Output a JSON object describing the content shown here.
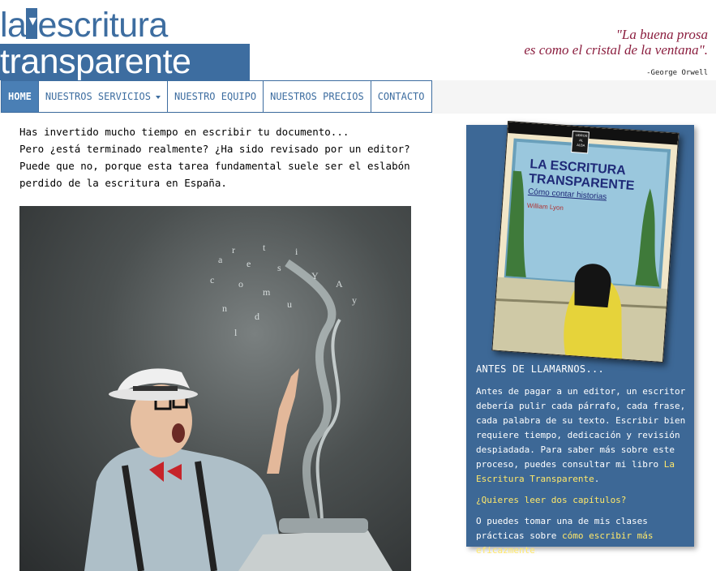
{
  "logo": {
    "line1": "la escritura",
    "line2": "transparente"
  },
  "quote": {
    "line1": "\"La buena prosa",
    "line2": "es como el cristal de la ventana\".",
    "author": "-George Orwell"
  },
  "nav": {
    "home": "HOME",
    "services": "NUESTROS SERVICIOS",
    "team": "NUESTRO EQUIPO",
    "prices": "NUESTROS PRECIOS",
    "contact": "CONTACTO"
  },
  "intro": {
    "line1": "Has invertido mucho tiempo en escribir tu documento...",
    "line2": "Pero ¿está terminado realmente? ¿Ha sido revisado por un editor?",
    "line3": "Puede que no, porque esta tarea fundamental suele ser el eslabón",
    "line4": "perdido de la escritura en España."
  },
  "book": {
    "badge_line1": "LIBROS",
    "badge_line2": "AL",
    "badge_line3": "ALBA",
    "title_line1": "LA ESCRITURA",
    "title_line2": "TRANSPARENTE",
    "subtitle": "Cómo contar historias",
    "author": "William Lyon"
  },
  "sidebar": {
    "heading": "ANTES DE LLAMARNOS...",
    "para1": "Antes de pagar a un editor, un escritor debería pulir cada párrafo, cada frase, cada palabra de su texto. Escribir bien requiere tiempo, dedicación y revisión despiadada. Para saber más sobre este proceso, puedes consultar mi libro ",
    "book_link": "La Escritura Transparente",
    "para1_end": ".",
    "chapters_link": "¿Quieres leer dos capítulos?",
    "para3": "O puedes tomar una de mis clases prácticas sobre ",
    "class_link": "cómo escribir más eficazmente",
    "para3_end": "."
  },
  "colors": {
    "brand": "#3d6da0",
    "quote": "#8b1e3f",
    "sidebar": "#3d6896",
    "link": "#ffe86a"
  },
  "icons": {
    "dropdown": "caret-down-icon"
  }
}
